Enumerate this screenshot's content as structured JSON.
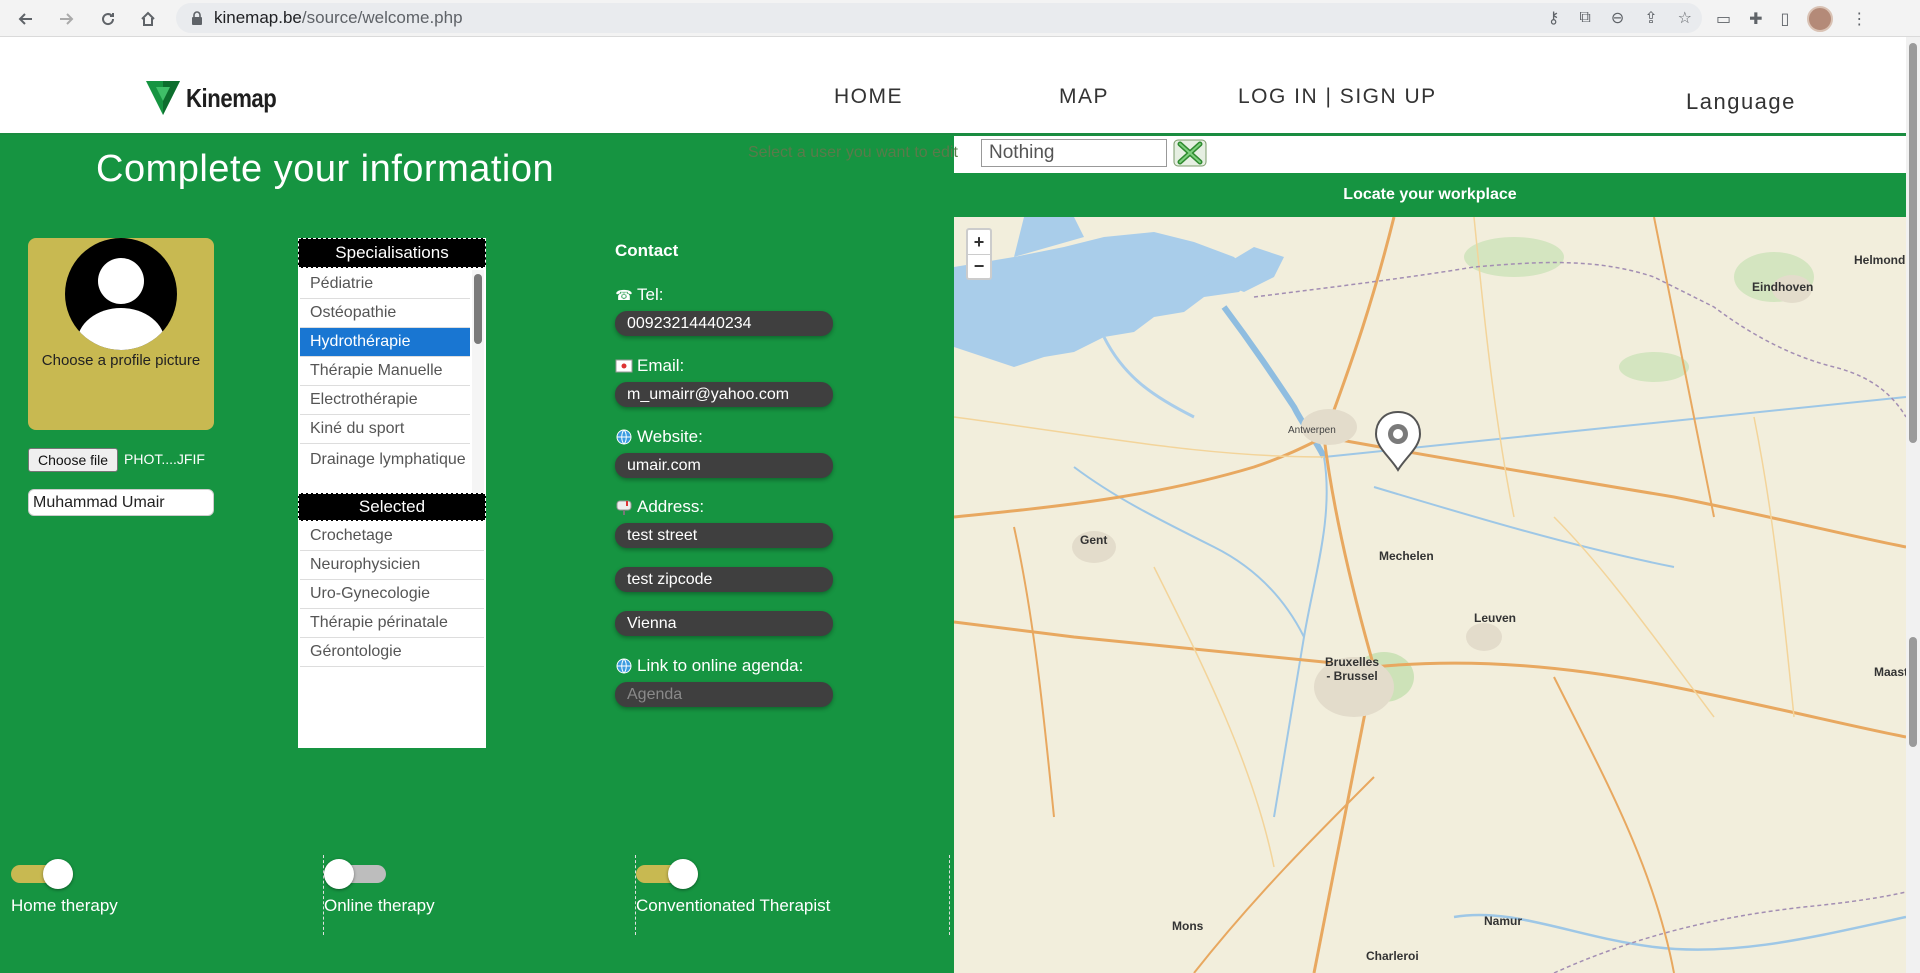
{
  "browser": {
    "url_domain": "kinemap.be",
    "url_path": "/source/welcome.php"
  },
  "header": {
    "logo_text": "Kinemap",
    "nav": [
      "HOME",
      "MAP",
      "LOG IN | SIGN UP"
    ],
    "language": "Language"
  },
  "page": {
    "title": "Complete your information",
    "user_select_label": "Select a user you want to edit",
    "user_select_value": "Nothing",
    "map_header": "Locate your workplace"
  },
  "profile": {
    "picture_label": "Choose a profile picture",
    "choose_file_label": "Choose file",
    "file_name": "PHOT....JFIF",
    "name": "Muhammad Umair"
  },
  "specialisations": {
    "header": "Specialisations",
    "items": [
      "Pédiatrie",
      "Ostéopathie",
      "Hydrothérapie",
      "Thérapie Manuelle",
      "Electrothérapie",
      "Kiné du sport",
      "Drainage lymphatique"
    ],
    "selected_index": 2,
    "selected_header": "Selected",
    "selected_items": [
      "Crochetage",
      "Neurophysicien",
      "Uro-Gynecologie",
      "Thérapie périnatale",
      "Gérontologie"
    ]
  },
  "contact": {
    "title": "Contact",
    "tel_label": "Tel:",
    "tel": "00923214440234",
    "email_label": "Email:",
    "email": "m_umairr@yahoo.com",
    "website_label": "Website:",
    "website": "umair.com",
    "address_label": "Address:",
    "street": "test street",
    "zipcode": "test zipcode",
    "city": "Vienna",
    "agenda_label": "Link to online agenda:",
    "agenda_placeholder": "Agenda"
  },
  "toggles": [
    {
      "label": "Home therapy",
      "on": true
    },
    {
      "label": "Online therapy",
      "on": false
    },
    {
      "label": "Conventionated Therapist",
      "on": true
    }
  ],
  "map": {
    "zoom_in": "+",
    "zoom_out": "−",
    "labels": [
      "Antwerpen",
      "Mechelen",
      "Gent",
      "Bruxelles - Brussel",
      "Leuven",
      "Eindhoven",
      "Helmond",
      "Namur",
      "Mons",
      "Charleroi",
      "Maastr"
    ]
  },
  "colors": {
    "green": "#169441",
    "gold": "#c8b951",
    "selected_blue": "#1976d2",
    "field_dark": "#3f3f3f"
  }
}
